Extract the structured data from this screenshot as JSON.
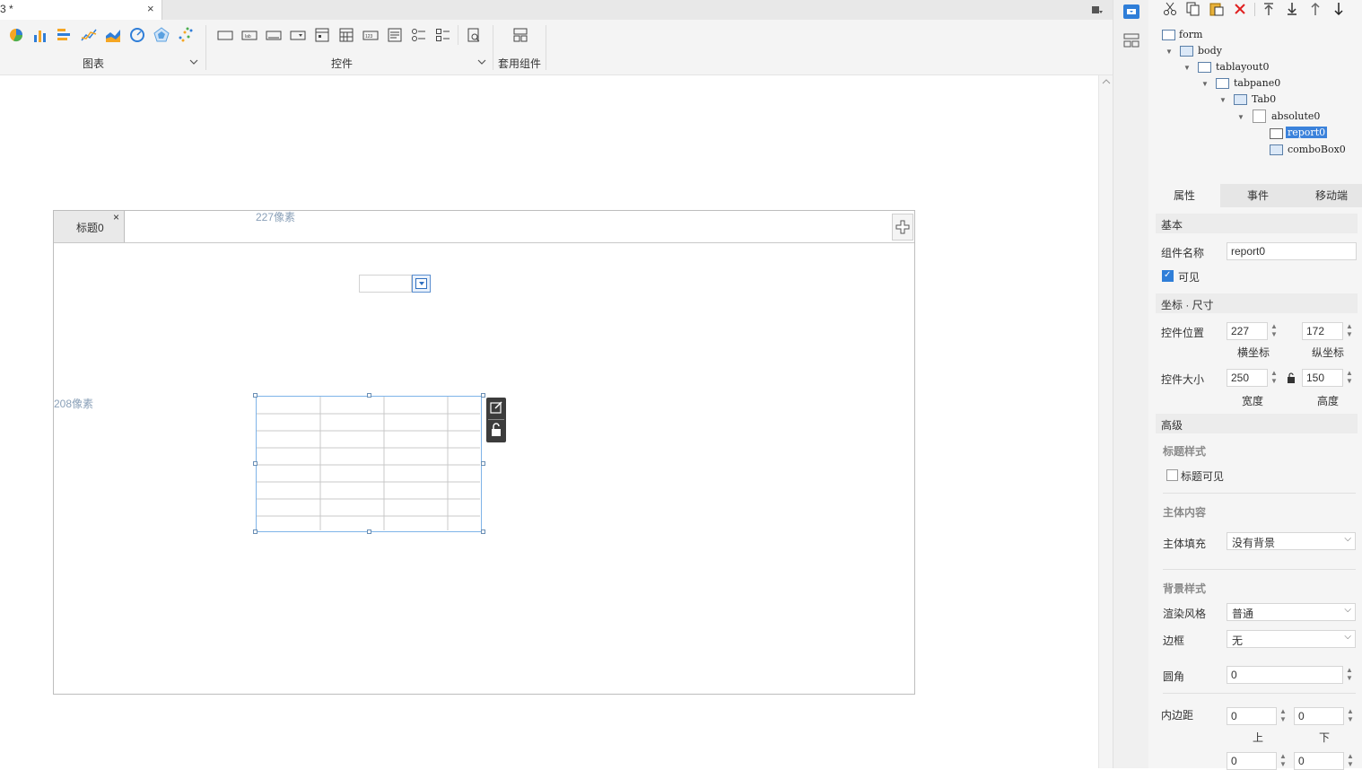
{
  "document_tab": {
    "title": "3 *",
    "close": "×"
  },
  "toolbar": {
    "groups": [
      {
        "label": "图表"
      },
      {
        "label": "控件"
      },
      {
        "label": "套用组件"
      }
    ],
    "chart_icons": [
      "pie-chart-icon",
      "bar-chart-icon",
      "horizontal-bar-chart-icon",
      "line-chart-icon",
      "area-chart-icon",
      "gauge-chart-icon",
      "radar-chart-icon",
      "scatter-chart-icon"
    ],
    "widget_icons": [
      "label-widget-icon",
      "text-widget-icon",
      "button-widget-icon",
      "combobox-widget-icon",
      "date-widget-icon",
      "calendar-widget-icon",
      "number-widget-icon",
      "textarea-widget-icon",
      "radio-group-widget-icon",
      "checkbox-group-widget-icon",
      "query-widget-icon"
    ],
    "accent": "#2f7ed8"
  },
  "canvas": {
    "tab_label": "标题0",
    "tab_close": "×",
    "ruler_x": "227像素",
    "ruler_y": "208像素"
  },
  "tree": {
    "items": [
      {
        "label": "form"
      },
      {
        "label": "body"
      },
      {
        "label": "tablayout0"
      },
      {
        "label": "tabpane0"
      },
      {
        "label": "Tab0"
      },
      {
        "label": "absolute0"
      },
      {
        "label": "report0"
      },
      {
        "label": "comboBox0"
      }
    ]
  },
  "props": {
    "tabs": [
      "属性",
      "事件",
      "移动端"
    ],
    "basic": {
      "header": "基本",
      "name_label": "组件名称",
      "name_value": "report0",
      "visible_label": "可见"
    },
    "coords": {
      "header": "坐标 · 尺寸",
      "pos_label": "控件位置",
      "x_value": "227",
      "y_value": "172",
      "x_caption": "横坐标",
      "y_caption": "纵坐标",
      "size_label": "控件大小",
      "w_value": "250",
      "h_value": "150",
      "w_caption": "宽度",
      "h_caption": "高度"
    },
    "advanced": {
      "header": "高级",
      "title_style": "标题样式",
      "title_visible": "标题可见",
      "body_content": "主体内容",
      "body_fill_label": "主体填充",
      "body_fill_value": "没有背景",
      "bg_style": "背景样式",
      "render_label": "渲染风格",
      "render_value": "普通",
      "border_label": "边框",
      "border_value": "无",
      "radius_label": "圆角",
      "radius_value": "0",
      "padding_label": "内边距",
      "pad_top": "0",
      "pad_bottom": "0",
      "pad_top_caption": "上",
      "pad_bottom_caption": "下",
      "pad_left": "0",
      "pad_right": "0"
    }
  }
}
